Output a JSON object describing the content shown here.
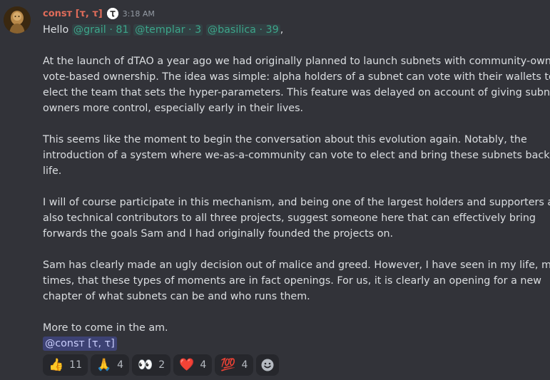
{
  "message": {
    "author": "conѕт [τ, τ]",
    "timestamp": "3:18 AM",
    "greeting": "Hello",
    "mentions": [
      {
        "name": "@grail",
        "count": "81"
      },
      {
        "name": "@templar",
        "count": "3"
      },
      {
        "name": "@basilica",
        "count": "39"
      }
    ],
    "separator": "·",
    "greeting_end": ",",
    "paragraphs": [
      [
        "At the launch of dTAO a year ago we had originally planned to launch subnets with community-owned",
        "vote-based ownership. The idea was simple: alpha holders of a subnet can vote with their wallets to",
        "elect the team that sets the hyper-parameters. This feature was delayed on account of giving subnet",
        "owners more control, especially early in their lives."
      ],
      [
        "This seems like the moment to begin the conversation about this evolution again. Notably, the",
        "introduction of a system where we-as-a-community can vote to elect and bring these subnets back to",
        "life."
      ],
      [
        "I will of course participate in this mechanism, and being one of the largest holders and supporters and",
        "also technical contributors to all three projects, suggest someone here that can effectively bring",
        "forwards the goals Sam and I had originally founded the projects on."
      ],
      [
        "Sam has clearly made an ugly decision out of malice and greed. However, I have seen in my life, many",
        "times, that these types of moments are in fact openings. For us, it is clearly an opening for a new",
        "chapter of what subnets can be and who runs them."
      ],
      [
        "More to come in the am."
      ]
    ],
    "signature_mention": "@conѕт [τ, τ]"
  },
  "reactions": [
    {
      "emoji": "👍",
      "icon": "thumbs-up-icon",
      "count": "11"
    },
    {
      "emoji": "🙏",
      "icon": "folded-hands-icon",
      "count": "4"
    },
    {
      "emoji": "👀",
      "icon": "eyes-icon",
      "count": "2"
    },
    {
      "emoji": "❤️",
      "icon": "red-heart-icon",
      "count": "4"
    },
    {
      "emoji": "💯",
      "icon": "hundred-points-icon",
      "count": "4"
    }
  ],
  "colors": {
    "background": "#323339",
    "username": "#e06c5a",
    "role_mention": "#3da58a",
    "user_mention_bg": "#434b8c",
    "reaction_bg": "#26272c"
  }
}
